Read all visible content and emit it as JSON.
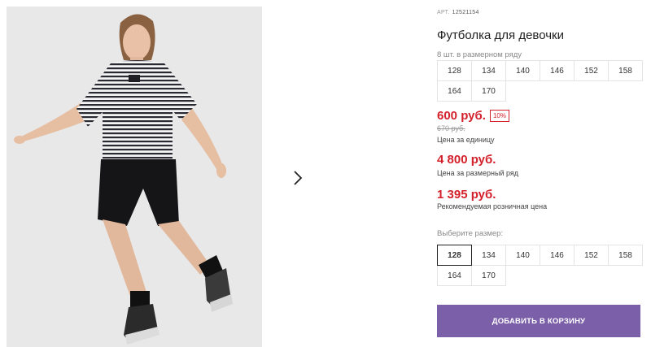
{
  "gallery": {
    "next_icon": "chevron-right-icon"
  },
  "product": {
    "article_label": "АРТ.",
    "article_number": "12521154",
    "title": "Футболка для девочки",
    "pack_note": "8 шт. в размерном ряду",
    "pack_sizes": [
      "128",
      "134",
      "140",
      "146",
      "152",
      "158",
      "164",
      "170"
    ],
    "price": "600 руб.",
    "discount": "10%",
    "old_price": "670 руб.",
    "unit_price_caption": "Цена за единицу",
    "row_price": "4 800 руб.",
    "row_price_caption": "Цена за размерный ряд",
    "retail_price": "1 395 руб.",
    "retail_price_caption": "Рекомендуемая розничная цена",
    "choose_size_label": "Выберите размер:",
    "sizes": [
      "128",
      "134",
      "140",
      "146",
      "152",
      "158",
      "164",
      "170"
    ],
    "selected_size": "128",
    "add_to_cart": "ДОБАВИТЬ В КОРЗИНУ"
  },
  "colors": {
    "price_red": "#d4202a",
    "button_purple": "#7b5fa8"
  }
}
